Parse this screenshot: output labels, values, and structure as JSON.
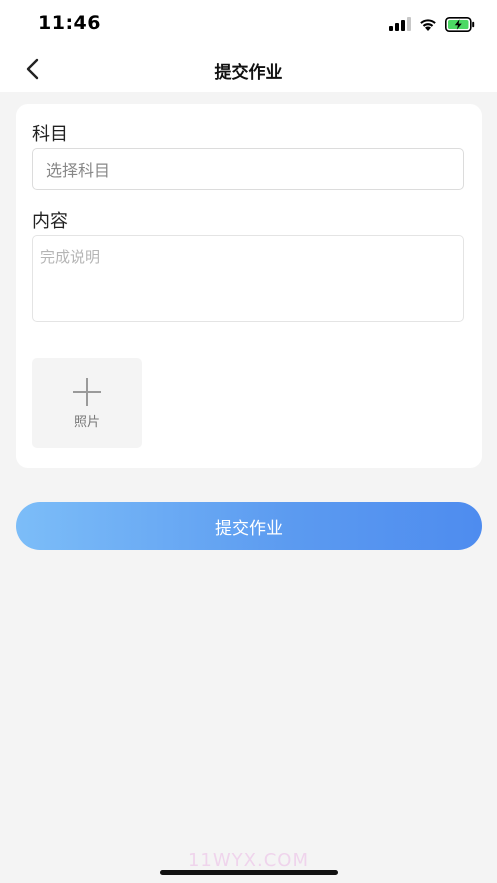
{
  "status_bar": {
    "time": "11:46",
    "icons": [
      "signal-icon",
      "wifi-icon",
      "battery-charging-icon"
    ]
  },
  "nav": {
    "back_icon": "chevron-left-icon",
    "title": "提交作业"
  },
  "form": {
    "subject_label": "科目",
    "subject_placeholder": "选择科目",
    "content_label": "内容",
    "content_placeholder": "完成说明",
    "photo_icon": "plus-icon",
    "photo_label": "照片"
  },
  "submit": {
    "label": "提交作业"
  },
  "watermark": {
    "text": "11WYX.COM"
  },
  "colors": {
    "background": "#f4f4f4",
    "button_gradient_start": "#7cbdf8",
    "button_gradient_end": "#4e8cef",
    "battery": "#4cd964"
  }
}
